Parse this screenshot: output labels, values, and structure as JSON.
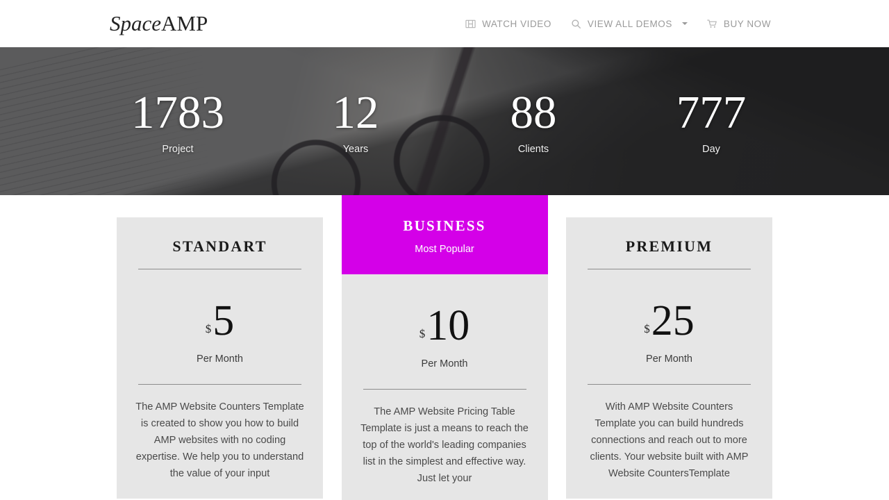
{
  "brand": {
    "part1": "Space",
    "part2": "AMP"
  },
  "nav": {
    "items": [
      {
        "icon": "film-icon",
        "label": "WATCH VIDEO",
        "caret": false
      },
      {
        "icon": "search-icon",
        "label": "VIEW ALL DEMOS",
        "caret": true
      },
      {
        "icon": "cart-icon",
        "label": "BUY NOW",
        "caret": false
      }
    ]
  },
  "hero": {
    "counters": [
      {
        "number": "1783",
        "label": "Project"
      },
      {
        "number": "12",
        "label": "Years"
      },
      {
        "number": "88",
        "label": "Clients"
      },
      {
        "number": "777",
        "label": "Day"
      }
    ]
  },
  "pricing": {
    "cards": [
      {
        "title": "STANDART",
        "subtitle": "",
        "featured": false,
        "currency": "$",
        "amount": "5",
        "period": "Per Month",
        "description": "The AMP Website Counters Template is created to show you how to build AMP websites with no coding expertise. We help you to understand the value of your input"
      },
      {
        "title": "BUSINESS",
        "subtitle": "Most Popular",
        "featured": true,
        "currency": "$",
        "amount": "10",
        "period": "Per Month",
        "description": "The AMP Website Pricing Table Template is just a means to reach the top of the world's leading companies list in the simplest and effective way. Just let your"
      },
      {
        "title": "PREMIUM",
        "subtitle": "",
        "featured": false,
        "currency": "$",
        "amount": "25",
        "period": "Per Month",
        "description": "With AMP Website  Counters Template you can build hundreds connections and reach out to more clients. Your website built with AMP Website CountersTemplate"
      }
    ]
  },
  "colors": {
    "accent": "#D400E8",
    "card_bg": "#E6E6E6",
    "nav_text": "#9A9A9A",
    "hero_overlay": "#262628"
  }
}
